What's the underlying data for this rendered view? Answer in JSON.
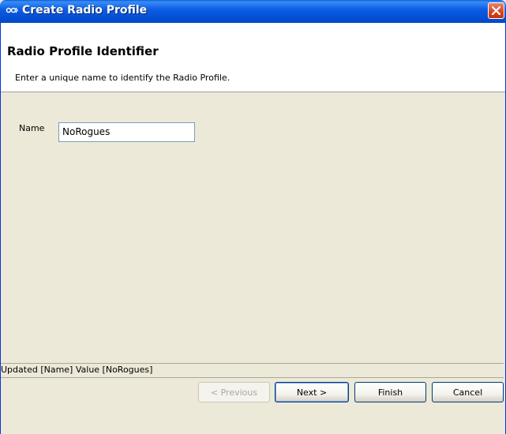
{
  "window": {
    "title": "Create Radio Profile",
    "app_icon_text": "ᵃᵇᶜ"
  },
  "header": {
    "title": "Radio Profile Identifier",
    "description": "Enter a unique name to identify the Radio Profile."
  },
  "form": {
    "name_label": "Name",
    "name_value": "NoRogues"
  },
  "status": {
    "text": "Updated [Name] Value [NoRogues]"
  },
  "buttons": {
    "previous": "< Previous",
    "next": "Next >",
    "finish": "Finish",
    "cancel": "Cancel"
  },
  "colors": {
    "titlebar": "#0552d6",
    "close_button": "#d8431d",
    "dialog_background": "#ece9d8"
  }
}
